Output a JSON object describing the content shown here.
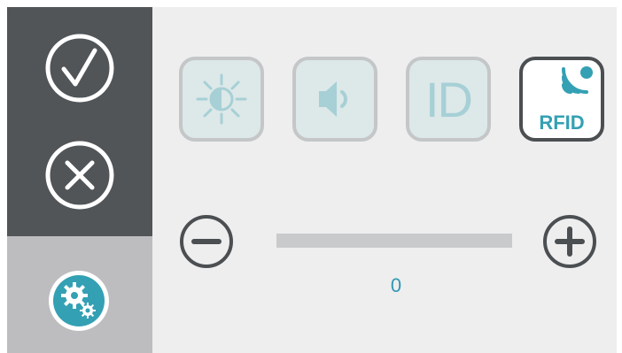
{
  "sidebar": {
    "confirm_icon": "check-circle-icon",
    "cancel_icon": "x-circle-icon",
    "settings_icon": "gears-icon"
  },
  "modes": [
    {
      "id": "brightness",
      "icon": "brightness-icon",
      "active": false
    },
    {
      "id": "volume",
      "icon": "speaker-icon",
      "active": false
    },
    {
      "id": "id",
      "icon": "id-icon",
      "label": "ID",
      "active": false
    },
    {
      "id": "rfid",
      "icon": "rfid-icon",
      "label": "RFID",
      "active": true
    }
  ],
  "slider": {
    "value": "0",
    "level": 0
  },
  "colors": {
    "sidebar_dark": "#515558",
    "sidebar_light": "#bdbdbf",
    "background": "#eeeeef",
    "accent": "#34a0b4",
    "inactive_icon": "#a6d0d6"
  }
}
